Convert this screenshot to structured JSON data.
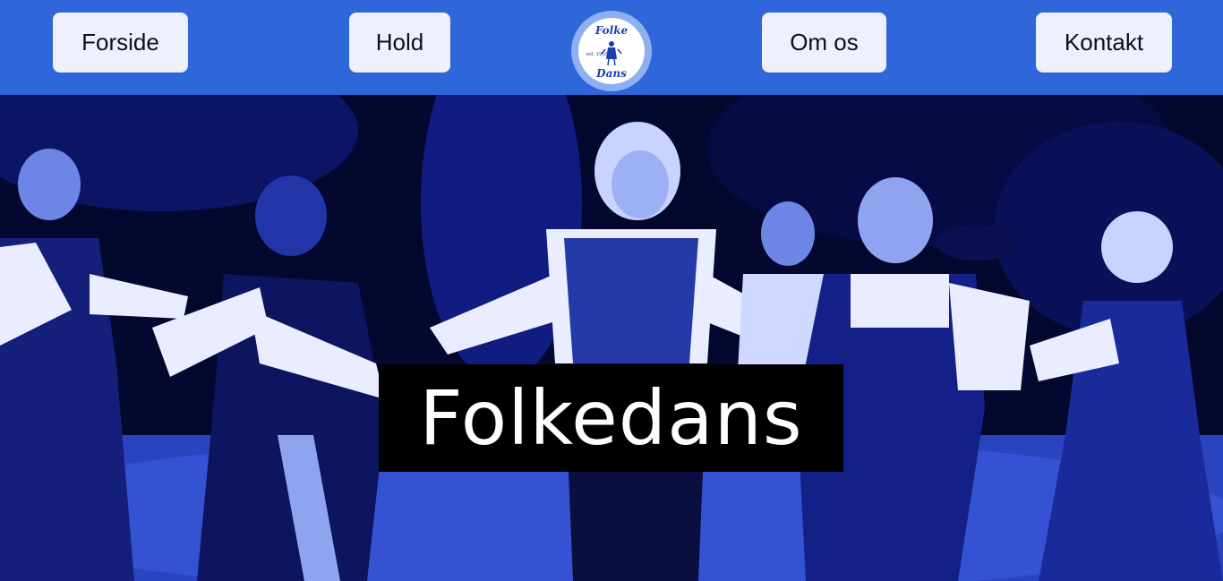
{
  "nav": {
    "items": [
      {
        "label": "Forside"
      },
      {
        "label": "Hold"
      },
      {
        "label": "Om os"
      },
      {
        "label": "Kontakt"
      }
    ],
    "logo": {
      "top_text": "Folke",
      "bottom_text": "Dans",
      "est_text": "est. 1950"
    }
  },
  "hero": {
    "title": "Folkedans",
    "image_icon": "folk-dancers-photo"
  },
  "colors": {
    "nav_bg": "#2f66d9",
    "button_bg": "#eef1fb",
    "title_box_bg": "#000000",
    "title_text": "#ffffff"
  }
}
